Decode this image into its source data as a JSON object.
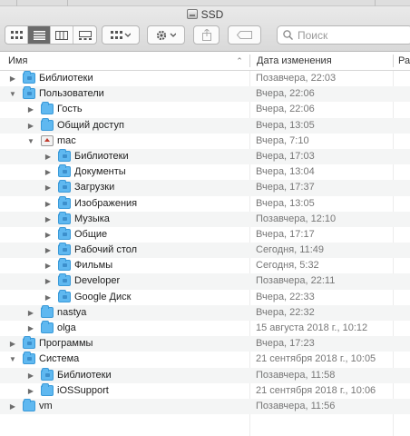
{
  "window": {
    "title": "SSD",
    "search_placeholder": "Поиск"
  },
  "toolbar": {
    "view_icons": [
      "icon-view-icon",
      "list-view-icon",
      "column-view-icon",
      "gallery-view-icon"
    ],
    "active_view": "list-view-icon"
  },
  "columns": {
    "name": "Имя",
    "date": "Дата изменения",
    "size": "Ра"
  },
  "colors": {
    "folder": "#5fb8f0",
    "active_view": "#6b6b6b",
    "date_text": "#777777"
  },
  "rows": [
    {
      "name": "Библиотеки",
      "date": "Позавчера, 22:03",
      "indent": 0,
      "expanded": false,
      "icon": "library-folder-icon"
    },
    {
      "name": "Пользователи",
      "date": "Вчера, 22:06",
      "indent": 0,
      "expanded": true,
      "icon": "users-folder-icon"
    },
    {
      "name": "Гость",
      "date": "Вчера, 22:06",
      "indent": 1,
      "expanded": false,
      "icon": "folder-icon"
    },
    {
      "name": "Общий доступ",
      "date": "Вчера, 13:05",
      "indent": 1,
      "expanded": false,
      "icon": "folder-icon"
    },
    {
      "name": "mac",
      "date": "Вчера, 7:10",
      "indent": 1,
      "expanded": true,
      "icon": "home-folder-icon"
    },
    {
      "name": "Библиотеки",
      "date": "Вчера, 17:03",
      "indent": 2,
      "expanded": false,
      "icon": "library-folder-icon"
    },
    {
      "name": "Документы",
      "date": "Вчера, 13:04",
      "indent": 2,
      "expanded": false,
      "icon": "documents-folder-icon"
    },
    {
      "name": "Загрузки",
      "date": "Вчера, 17:37",
      "indent": 2,
      "expanded": false,
      "icon": "downloads-folder-icon"
    },
    {
      "name": "Изображения",
      "date": "Вчера, 13:05",
      "indent": 2,
      "expanded": false,
      "icon": "pictures-folder-icon"
    },
    {
      "name": "Музыка",
      "date": "Позавчера, 12:10",
      "indent": 2,
      "expanded": false,
      "icon": "music-folder-icon"
    },
    {
      "name": "Общие",
      "date": "Вчера, 17:17",
      "indent": 2,
      "expanded": false,
      "icon": "public-folder-icon"
    },
    {
      "name": "Рабочий стол",
      "date": "Сегодня, 11:49",
      "indent": 2,
      "expanded": false,
      "icon": "desktop-folder-icon"
    },
    {
      "name": "Фильмы",
      "date": "Сегодня, 5:32",
      "indent": 2,
      "expanded": false,
      "icon": "movies-folder-icon"
    },
    {
      "name": "Developer",
      "date": "Позавчера, 22:11",
      "indent": 2,
      "expanded": false,
      "icon": "developer-folder-icon"
    },
    {
      "name": "Google Диск",
      "date": "Вчера, 22:33",
      "indent": 2,
      "expanded": false,
      "icon": "google-drive-folder-icon"
    },
    {
      "name": "nastya",
      "date": "Вчера, 22:32",
      "indent": 1,
      "expanded": false,
      "icon": "folder-icon"
    },
    {
      "name": "olga",
      "date": "15 августа 2018 г., 10:12",
      "indent": 1,
      "expanded": false,
      "icon": "folder-icon"
    },
    {
      "name": "Программы",
      "date": "Вчера, 17:23",
      "indent": 0,
      "expanded": false,
      "icon": "applications-folder-icon"
    },
    {
      "name": "Система",
      "date": "21 сентября 2018 г., 10:05",
      "indent": 0,
      "expanded": true,
      "icon": "system-folder-icon"
    },
    {
      "name": "Библиотеки",
      "date": "Позавчера, 11:58",
      "indent": 1,
      "expanded": false,
      "icon": "library-folder-icon"
    },
    {
      "name": "iOSSupport",
      "date": "21 сентября 2018 г., 10:06",
      "indent": 1,
      "expanded": false,
      "icon": "folder-icon"
    },
    {
      "name": "vm",
      "date": "Позавчера, 11:56",
      "indent": 0,
      "expanded": false,
      "icon": "folder-icon"
    }
  ]
}
